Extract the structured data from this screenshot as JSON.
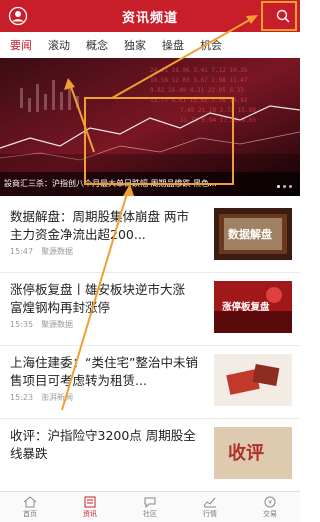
{
  "header": {
    "title": "资讯频道",
    "user_icon": "user-icon",
    "search_icon": "search-icon"
  },
  "tabs": [
    {
      "label": "要闻",
      "active": true
    },
    {
      "label": "滚动"
    },
    {
      "label": "概念"
    },
    {
      "label": "独家"
    },
    {
      "label": "操盘"
    },
    {
      "label": "机会"
    }
  ],
  "hero": {
    "caption": "設商汇三杀：沪指创八个月最大单日跌幅 周期品惨跌 黑色..."
  },
  "news": [
    {
      "title": "数据解盘：周期股集体崩盘 两市主力资金净流出超200...",
      "time": "15:47",
      "source": "聚源数据",
      "thumb_text": "数据解盘"
    },
    {
      "title": "涨停板复盘丨雄安板块逆市大涨 富煌钢构再封涨停",
      "time": "15:35",
      "source": "聚源数据",
      "thumb_text": "涨停板复盘"
    },
    {
      "title": "上海住建委：“类住宅”整治中未销售项目可考虑转为租赁...",
      "time": "15:23",
      "source": "澎湃新闻",
      "thumb_text": ""
    },
    {
      "title": "收评：沪指险守3200点 周期股全线暴跌",
      "time": "",
      "source": "",
      "thumb_text": "收评"
    }
  ],
  "bottom_nav": [
    {
      "label": "首页",
      "icon": "home-icon"
    },
    {
      "label": "资讯",
      "icon": "news-icon",
      "active": true
    },
    {
      "label": "社区",
      "icon": "chat-icon"
    },
    {
      "label": "行情",
      "icon": "market-icon"
    },
    {
      "label": "交易",
      "icon": "trade-icon"
    }
  ],
  "colors": {
    "brand": "#c81e2a",
    "annotation": "#f0a030"
  }
}
